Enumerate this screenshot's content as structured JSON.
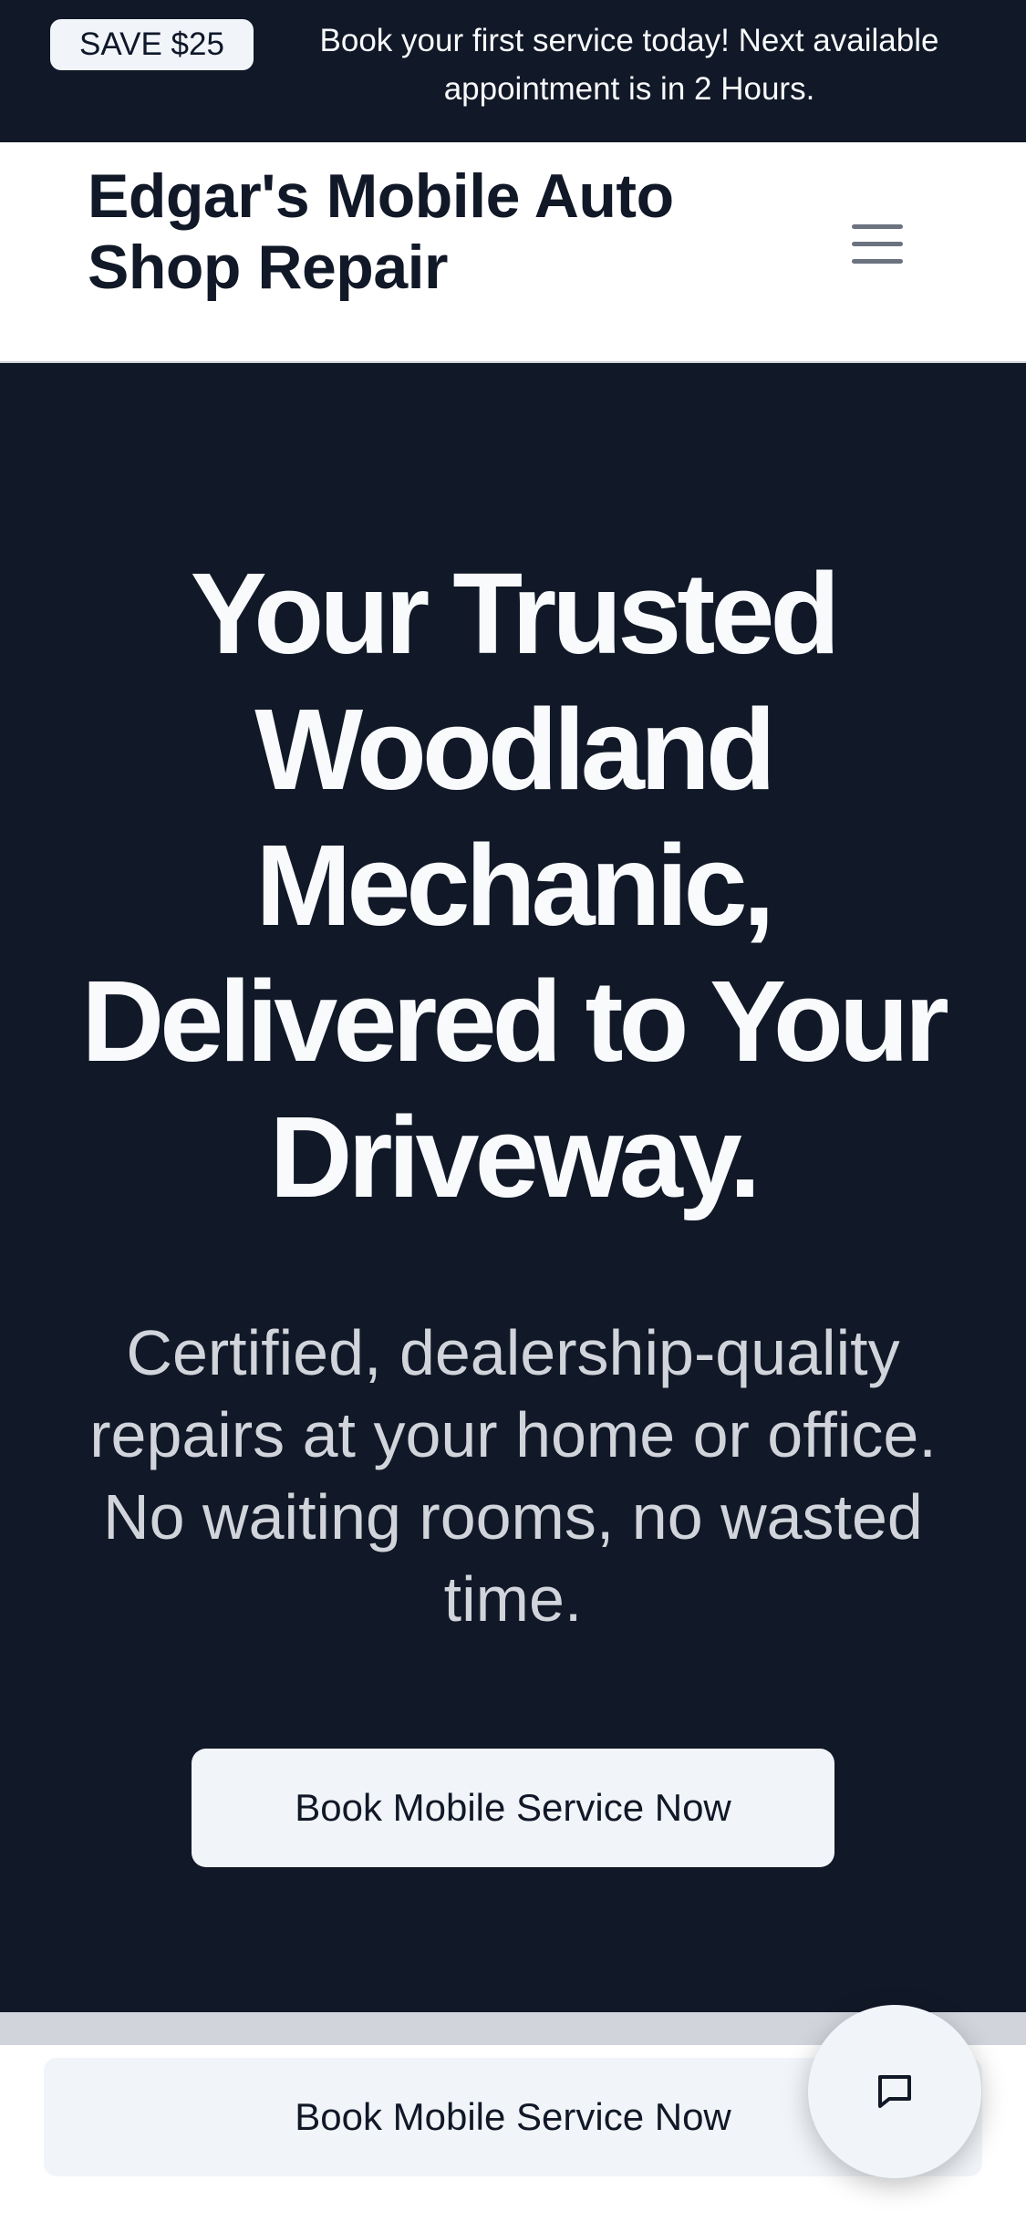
{
  "announcement": {
    "badge": "SAVE $25",
    "text": "Book your first service today! Next available appointment is in 2 Hours."
  },
  "header": {
    "brand": "Edgar's Mobile Auto Shop Repair",
    "menu_icon": "hamburger-menu-icon"
  },
  "hero": {
    "title": "Your Trusted Woodland Mechanic, Delivered to Your Driveway.",
    "subtitle": "Certified, dealership-quality repairs at your home or office. No waiting rooms, no wasted time.",
    "cta_label": "Book Mobile Service Now"
  },
  "sticky_bar": {
    "cta_label": "Book Mobile Service Now"
  },
  "chat": {
    "icon": "chat-bubble-icon"
  },
  "colors": {
    "dark_bg": "#111827",
    "light_button": "#f1f5f9",
    "text_light": "#f8fafc",
    "text_dark": "#111827"
  }
}
